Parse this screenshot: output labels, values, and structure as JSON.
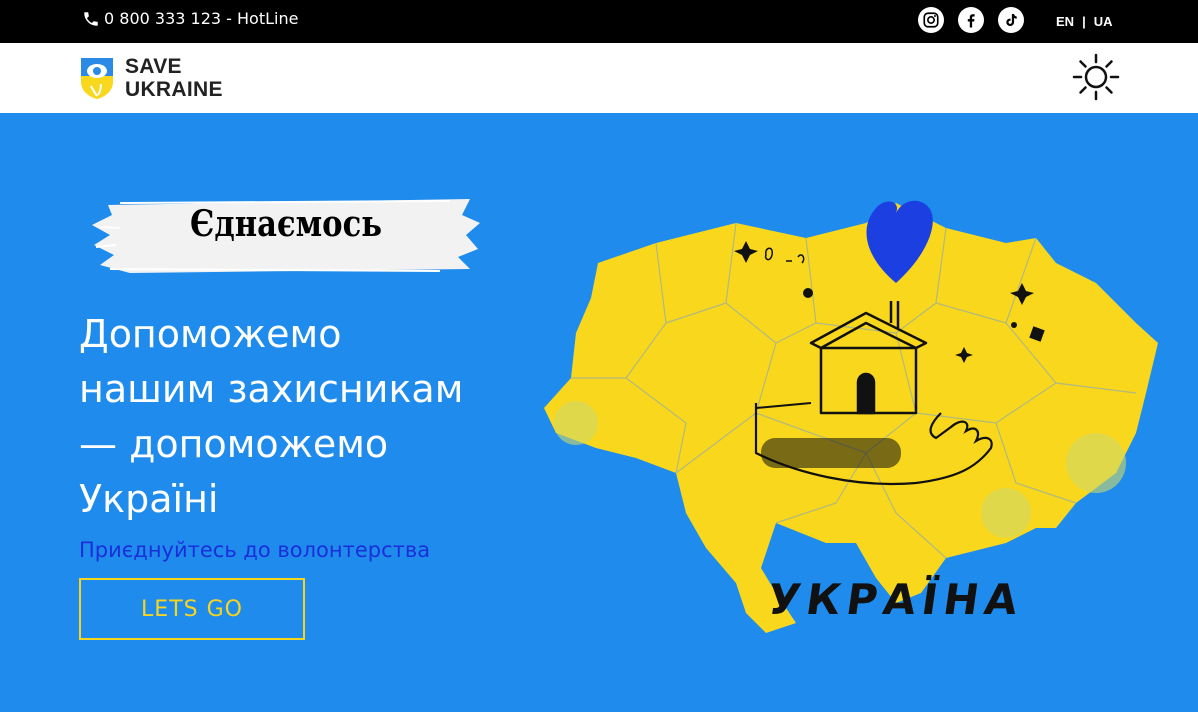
{
  "topbar": {
    "hotline_text": "0 800 333 123 - HotLine",
    "socials": [
      {
        "name": "instagram-icon"
      },
      {
        "name": "facebook-icon"
      },
      {
        "name": "tiktok-icon"
      }
    ],
    "lang_en": "EN",
    "lang_sep": "|",
    "lang_ua": "UA"
  },
  "navbar": {
    "logo_line1": "SAVE",
    "logo_line2": "UKRAINE",
    "theme_icon": "sun-icon"
  },
  "hero": {
    "badge": "Єднаємось",
    "headline_lines": [
      "Допоможемо",
      "нашим захисникам",
      "— допоможемо",
      "Україні"
    ],
    "join_link": "Приєднуйтесь до волонтерства",
    "cta_label": "LETS GO",
    "map_label": "УКРАЇНА"
  },
  "colors": {
    "hero_bg": "#1f8ced",
    "map_yellow": "#f9d71c",
    "heart_blue": "#1b3fe0",
    "cta_yellow": "#f7d51c",
    "link_blue": "#1a2fd9"
  }
}
